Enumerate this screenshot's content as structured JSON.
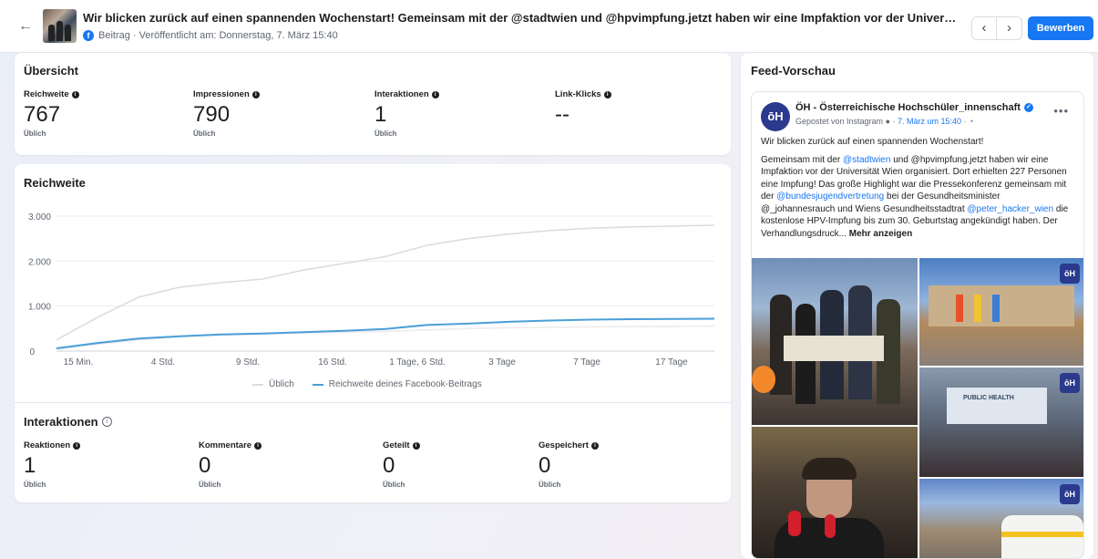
{
  "header": {
    "back_icon": "back-arrow-icon",
    "title": "Wir blicken zurück auf einen spannenden Wochenstart! Gemeinsam mit der @stadtwien und @hpvimpfung.jetzt haben wir eine Impfaktion vor der Universität Wien organisiert...",
    "meta": "Beitrag · Veröffentlicht am: Donnerstag, 7. März 15:40",
    "prev_icon": "‹",
    "next_icon": "›",
    "boost_label": "Bewerben"
  },
  "overview": {
    "title": "Übersicht",
    "metrics": [
      {
        "label": "Reichweite",
        "value": "767",
        "sub": "Üblich"
      },
      {
        "label": "Impressionen",
        "value": "790",
        "sub": "Üblich"
      },
      {
        "label": "Interaktionen",
        "value": "1",
        "sub": "Üblich"
      },
      {
        "label": "Link-Klicks",
        "value": "--",
        "sub": ""
      }
    ]
  },
  "reach": {
    "title": "Reichweite",
    "legend": [
      "Üblich",
      "Reichweite deines Facebook-Beitrags"
    ]
  },
  "chart_data": {
    "type": "line",
    "title": "Reichweite",
    "xlabel": "",
    "ylabel": "",
    "ylim": [
      0,
      3000
    ],
    "y_ticks": [
      "0",
      "1.000",
      "2.000",
      "3.000"
    ],
    "x_tick_labels": [
      "15 Min.",
      "4 Std.",
      "9 Std.",
      "16 Std.",
      "1 Tage, 6 Std.",
      "3 Tage",
      "7 Tage",
      "17 Tage"
    ],
    "x": [
      0,
      1,
      2,
      3,
      4,
      5,
      6,
      7,
      8,
      9,
      10,
      11,
      12,
      13,
      14,
      15,
      16
    ],
    "series": [
      {
        "name": "Üblich",
        "color": "#dadde1",
        "values": [
          250,
          750,
          1200,
          1420,
          1520,
          1600,
          1800,
          1950,
          2100,
          2350,
          2500,
          2600,
          2680,
          2730,
          2760,
          2780,
          2800
        ]
      },
      {
        "name": "Reichweite deines Facebook-Beitrags",
        "color": "#4a9fd8",
        "values": [
          60,
          180,
          280,
          330,
          370,
          390,
          420,
          450,
          490,
          580,
          610,
          650,
          680,
          700,
          710,
          715,
          720
        ]
      },
      {
        "name": "",
        "color": "#ececec",
        "values": [
          40,
          150,
          250,
          320,
          350,
          380,
          400,
          420,
          440,
          470,
          500,
          520,
          530,
          540,
          545,
          550,
          555
        ]
      }
    ],
    "grid": true,
    "legend_position": "bottom"
  },
  "interactions": {
    "title": "Interaktionen",
    "metrics": [
      {
        "label": "Reaktionen",
        "value": "1",
        "sub": "Üblich"
      },
      {
        "label": "Kommentare",
        "value": "0",
        "sub": "Üblich"
      },
      {
        "label": "Geteilt",
        "value": "0",
        "sub": "Üblich"
      },
      {
        "label": "Gespeichert",
        "value": "0",
        "sub": "Üblich"
      }
    ]
  },
  "preview": {
    "title": "Feed-Vorschau",
    "avatar_text": "ōH",
    "page_name": "ÖH - Österreichische Hochschüler_innenschaft",
    "posted_via": "Gepostet von Instagram",
    "date_link": "7. März um 15:40",
    "p1": "Wir blicken zurück auf einen spannenden Wochenstart!",
    "p2_a": "Gemeinsam mit der ",
    "p2_mention1": "@stadtwien",
    "p2_b": " und @hpvimpfung.jetzt haben wir eine Impfaktion vor der Universität Wien organisiert. Dort erhielten 227 Personen eine Impfung! Das große Highlight war die Pressekonferenz gemeinsam mit der ",
    "p2_mention2": "@bundesjugendvertretung",
    "p2_c": " bei der Gesundheitsminister @_johannesrauch und Wiens Gesundheitsstadtrat ",
    "p2_mention3": "@peter_hacker_wien",
    "p2_d": " die kostenlose HPV-Impfung bis zum 30. Geburtstag angekündigt haben. Der Verhandlungsdruck... ",
    "more_label": "Mehr anzeigen",
    "photo_label": "PUBLIC HEALTH",
    "photo_badge": "ōH"
  }
}
